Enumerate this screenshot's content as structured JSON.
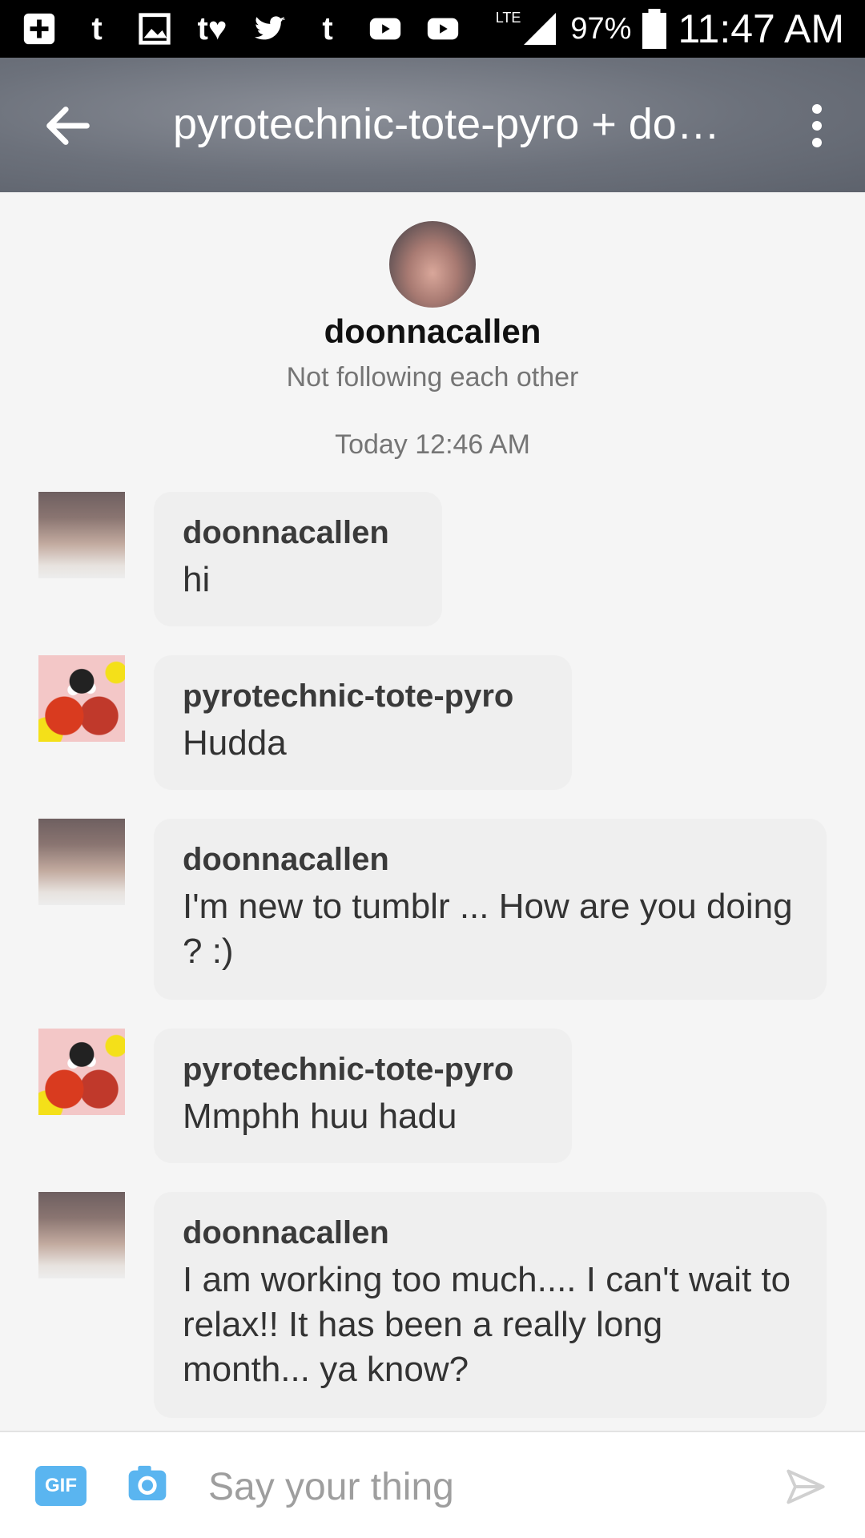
{
  "status_bar": {
    "notification_icons": [
      "plus-box-icon",
      "tumblr-icon",
      "image-icon",
      "tumblr-heart-icon",
      "twitter-icon",
      "tumblr-icon",
      "youtube-icon",
      "youtube-icon"
    ],
    "network": "LTE",
    "battery": "97%",
    "time": "11:47 AM"
  },
  "appbar": {
    "title": "pyrotechnic-tote-pyro + doonnacallen",
    "back_icon": "arrow-left-icon",
    "menu_icon": "more-vertical-icon"
  },
  "conversation": {
    "name": "doonnacallen",
    "relationship": "Not following each other",
    "timestamp": "Today 12:46 AM"
  },
  "messages": [
    {
      "sender": "doonnacallen",
      "text": "hi"
    },
    {
      "sender": "pyrotechnic-tote-pyro",
      "text": "Hudda"
    },
    {
      "sender": "doonnacallen",
      "text": "I'm  new to tumblr  ... How are you doing ? :)"
    },
    {
      "sender": "pyrotechnic-tote-pyro",
      "text": "Mmphh huu hadu"
    },
    {
      "sender": "doonnacallen",
      "text": "I am working too much.... I can't wait to relax!!  It has been a really long month... ya know?"
    }
  ],
  "composer": {
    "gif_label": "GIF",
    "placeholder": "Say your thing"
  },
  "colors": {
    "appbar": "#6c717b",
    "bubble": "#efefef",
    "accent": "#5ab5f0"
  }
}
